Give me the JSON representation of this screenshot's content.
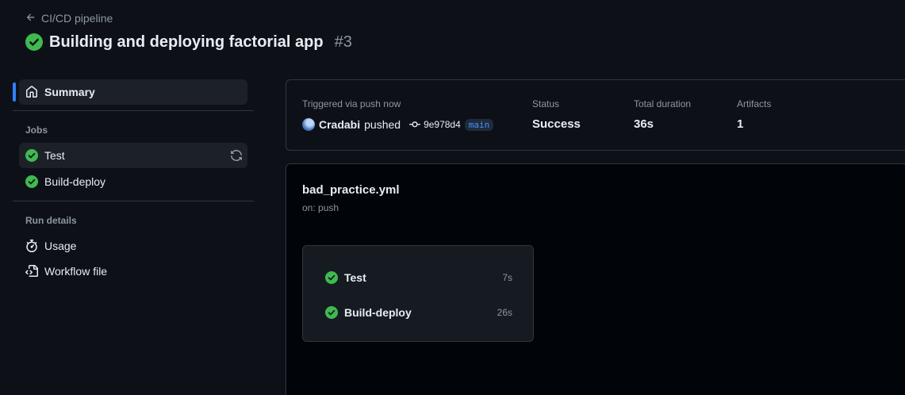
{
  "header": {
    "back_link": "CI/CD pipeline",
    "run_title": "Building and deploying factorial app",
    "run_number": "#3"
  },
  "sidebar": {
    "summary_label": "Summary",
    "jobs_heading": "Jobs",
    "jobs": [
      {
        "label": "Test",
        "status": "success",
        "icon": "check-circle-icon"
      },
      {
        "label": "Build-deploy",
        "status": "success",
        "icon": "check-circle-icon"
      }
    ],
    "run_details_heading": "Run details",
    "usage_label": "Usage",
    "workflow_file_label": "Workflow file"
  },
  "summary": {
    "trigger_label": "Triggered via push now",
    "actor": "Cradabi",
    "action": "pushed",
    "commit_sha": "9e978d4",
    "branch": "main",
    "status_label": "Status",
    "status_value": "Success",
    "duration_label": "Total duration",
    "duration_value": "36s",
    "artifacts_label": "Artifacts",
    "artifacts_value": "1"
  },
  "workflow": {
    "file_name": "bad_practice.yml",
    "trigger": "on: push",
    "jobs": [
      {
        "label": "Test",
        "duration": "7s"
      },
      {
        "label": "Build-deploy",
        "duration": "26s"
      }
    ]
  },
  "colors": {
    "background": "#0d1117",
    "success": "#3fb950",
    "accent": "#2f81f7"
  }
}
